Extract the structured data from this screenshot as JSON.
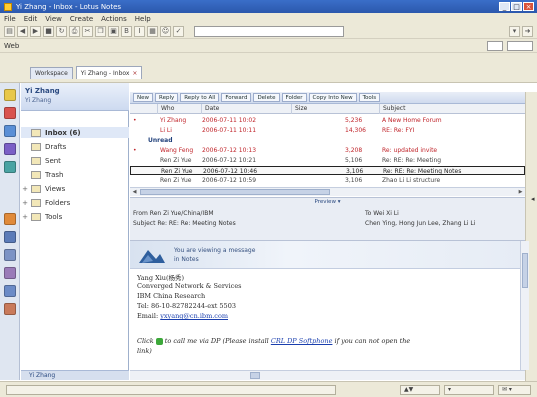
{
  "window": {
    "title": "Yi Zhang - Inbox - Lotus Notes"
  },
  "menu": [
    "File",
    "Edit",
    "View",
    "Create",
    "Actions",
    "Help"
  ],
  "toolbar2": {
    "label": "Web"
  },
  "tabs": [
    {
      "label": "Workspace"
    },
    {
      "label": "Yi Zhang - Inbox"
    }
  ],
  "folder_pane": {
    "title": "Yi Zhang",
    "subtitle": "Yi Zhang",
    "folders": [
      {
        "label": "Inbox (6)",
        "expand": ""
      },
      {
        "label": "Drafts",
        "expand": ""
      },
      {
        "label": "Sent",
        "expand": ""
      },
      {
        "label": "Trash",
        "expand": ""
      },
      {
        "label": "Views",
        "expand": "+"
      },
      {
        "label": "Folders",
        "expand": "+"
      },
      {
        "label": "Tools",
        "expand": "+"
      }
    ],
    "footer": "Yi Zhang"
  },
  "list_toolbar": [
    "New",
    "Reply",
    "Reply to All",
    "Forward",
    "Delete",
    "Folder",
    "Copy Into New",
    "Tools"
  ],
  "columns": {
    "who": "Who",
    "date": "Date",
    "size": "Size",
    "subject": "Subject"
  },
  "rows": [
    {
      "style": "red",
      "bullet": "•",
      "who": "Yi Zhang",
      "date": "2006-07-11 10:02",
      "size": "5,236",
      "subject": "A New Home Forum"
    },
    {
      "style": "red",
      "bullet": "",
      "who": "Li Li",
      "date": "2006-07-11 10:11",
      "size": "14,306",
      "subject": "RE: Re: FYI"
    },
    {
      "style": "grp",
      "label": "Unread"
    },
    {
      "style": "red",
      "bullet": "•",
      "who": "Wang Feng",
      "date": "2006-07-12 10:13",
      "size": "3,208",
      "subject": "Re: updated invite"
    },
    {
      "style": "plain",
      "bullet": "",
      "who": "Ren Zi Yue",
      "date": "2006-07-12 10:21",
      "size": "5,106",
      "subject": "Re: RE: Re: Meeting"
    },
    {
      "style": "selrow",
      "bullet": "",
      "who": "Ren Zi Yue",
      "date": "2006-07-12 10:46",
      "size": "3,106",
      "subject": "Re: RE: Re: Meeting Notes"
    },
    {
      "style": "plain",
      "bullet": "",
      "who": "Ren Zi Yue",
      "date": "2006-07-12 10:59",
      "size": "3,106",
      "subject": "Zhao Li Li structure"
    }
  ],
  "preview_header": {
    "title": "Preview",
    "from_label": "From",
    "from_value": "Ren Zi Yue/China/IBM",
    "to_label": "To",
    "to_value": "Wei Xi Li",
    "subject_label": "Subject",
    "subject_value": "Re: RE: Re: Meeting Notes",
    "cc_value": "Chen Ying, Hong Jun Lee, Zhang Li Li"
  },
  "banner": {
    "line1": "You are viewing a message",
    "line2": "in Notes"
  },
  "signature": [
    "Yang Xiu(杨秀)",
    "Converged Network & Services",
    "IBM China Research",
    "Tel: 86-10-82782244-ext 5503",
    "Email: "
  ],
  "signature_email": "yxyang@cn.ibm.com",
  "click_line": {
    "prefix": "Click",
    "text": "to call me via DP (Please install",
    "link": "CRL DP Softphone",
    "suffix": "if you can not open the",
    "line2": "link)"
  },
  "colors": {
    "accent": "#2b58ad",
    "unread": "#c0242a",
    "link": "#1a3fae"
  }
}
